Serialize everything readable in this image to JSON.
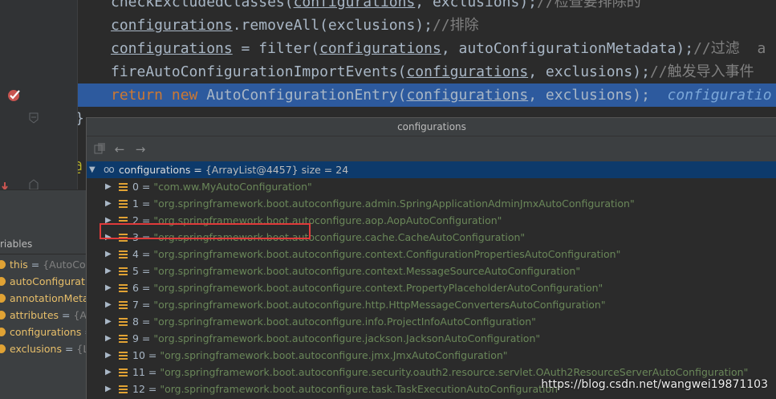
{
  "editor": {
    "lines": [
      {
        "id": "check",
        "parts": [
          {
            "t": "checkExcludedClasses(",
            "c": ""
          },
          {
            "t": "configurations",
            "c": "ul"
          },
          {
            "t": ", exclusions);",
            "c": ""
          },
          {
            "t": "//检查要排除的",
            "c": "cm"
          }
        ]
      },
      {
        "id": "remove",
        "parts": [
          {
            "t": "configurations",
            "c": "ul"
          },
          {
            "t": ".removeAll(exclusions);",
            "c": ""
          },
          {
            "t": "//排除",
            "c": "cm"
          }
        ]
      },
      {
        "id": "filter",
        "parts": [
          {
            "t": "configurations",
            "c": "ul fld"
          },
          {
            "t": " = filter(",
            "c": ""
          },
          {
            "t": "configurations",
            "c": "ul"
          },
          {
            "t": ", autoConfigurationMetadata);",
            "c": ""
          },
          {
            "t": "//过滤  a",
            "c": "cm"
          }
        ]
      },
      {
        "id": "fire",
        "parts": [
          {
            "t": "fireAutoConfigurationImportEvents(",
            "c": ""
          },
          {
            "t": "configurations",
            "c": "ul"
          },
          {
            "t": ", exclusions);",
            "c": ""
          },
          {
            "t": "//触发导入事件",
            "c": "cm"
          }
        ]
      },
      {
        "id": "return",
        "parts": [
          {
            "t": "return",
            "c": "kw"
          },
          {
            "t": " ",
            "c": ""
          },
          {
            "t": "new",
            "c": "kw"
          },
          {
            "t": " AutoConfigurationEntry(",
            "c": ""
          },
          {
            "t": "configurations",
            "c": "ul"
          },
          {
            "t": ", exclusions);  ",
            "c": ""
          },
          {
            "t": "configuratio",
            "c": "inl"
          }
        ]
      },
      {
        "id": "close",
        "parts": [
          {
            "t": "}",
            "c": ""
          }
        ]
      }
    ],
    "annotation_mark": "@"
  },
  "variables": {
    "tab_label": "riables",
    "items": [
      {
        "name": "this",
        "eq": " = ",
        "val": "{AutoConf"
      },
      {
        "name": "autoConfiguratio",
        "eq": "",
        "val": ""
      },
      {
        "name": "annotationMetad",
        "eq": "",
        "val": ""
      },
      {
        "name": "attributes",
        "eq": " = ",
        "val": "{Ann"
      },
      {
        "name": "configurations",
        "eq": " = ",
        "val": ""
      },
      {
        "name": "exclusions",
        "eq": " = ",
        "val": "{Lin"
      }
    ]
  },
  "popup": {
    "title": "configurations",
    "root": {
      "name": "configurations",
      "eq": " = ",
      "value": "{ArrayList@4457}",
      "size": "  size = 24"
    },
    "items": [
      {
        "index": "0",
        "value": "\"com.ww.MyAutoConfiguration\""
      },
      {
        "index": "1",
        "value": "\"org.springframework.boot.autoconfigure.admin.SpringApplicationAdminJmxAutoConfiguration\""
      },
      {
        "index": "2",
        "value": "\"org.springframework.boot.autoconfigure.aop.AopAutoConfiguration\""
      },
      {
        "index": "3",
        "value": "\"org.springframework.boot.autoconfigure.cache.CacheAutoConfiguration\""
      },
      {
        "index": "4",
        "value": "\"org.springframework.boot.autoconfigure.context.ConfigurationPropertiesAutoConfiguration\""
      },
      {
        "index": "5",
        "value": "\"org.springframework.boot.autoconfigure.context.MessageSourceAutoConfiguration\""
      },
      {
        "index": "6",
        "value": "\"org.springframework.boot.autoconfigure.context.PropertyPlaceholderAutoConfiguration\""
      },
      {
        "index": "7",
        "value": "\"org.springframework.boot.autoconfigure.http.HttpMessageConvertersAutoConfiguration\""
      },
      {
        "index": "8",
        "value": "\"org.springframework.boot.autoconfigure.info.ProjectInfoAutoConfiguration\""
      },
      {
        "index": "9",
        "value": "\"org.springframework.boot.autoconfigure.jackson.JacksonAutoConfiguration\""
      },
      {
        "index": "10",
        "value": "\"org.springframework.boot.autoconfigure.jmx.JmxAutoConfiguration\""
      },
      {
        "index": "11",
        "value": "\"org.springframework.boot.autoconfigure.security.oauth2.resource.servlet.OAuth2ResourceServerAutoConfiguration\""
      },
      {
        "index": "12",
        "value": "\"org.springframework.boot.autoconfigure.task.TaskExecutionAutoConfiguration\""
      }
    ]
  },
  "watermark": "https://blog.csdn.net/wangwei19871103",
  "colors": {
    "string": "#6a8759",
    "keyword": "#cc7832",
    "selection": "#2d5a9e",
    "highlight_box": "#e03a3a"
  }
}
